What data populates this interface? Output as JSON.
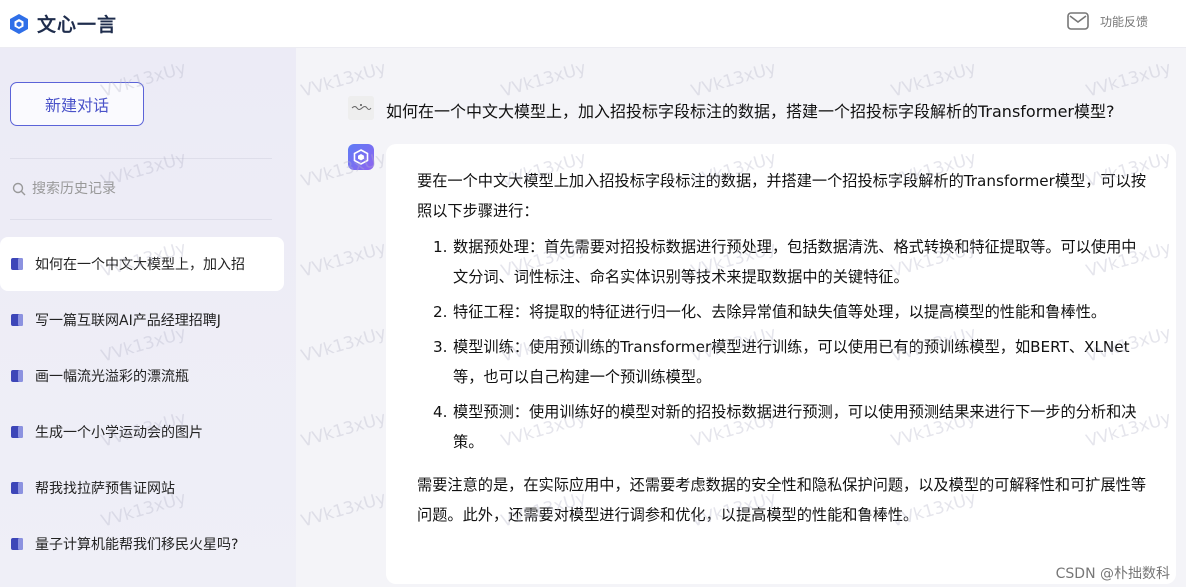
{
  "brand": {
    "name": "文心一言"
  },
  "topbar": {
    "feedback_label": "功能反馈"
  },
  "sidebar": {
    "new_chat_label": "新建对话",
    "search_placeholder": "搜索历史记录",
    "history": [
      {
        "label": "如何在一个中文大模型上，加入招",
        "active": true
      },
      {
        "label": "写一篇互联网AI产品经理招聘J",
        "active": false
      },
      {
        "label": "画一幅流光溢彩的漂流瓶",
        "active": false
      },
      {
        "label": "生成一个小学运动会的图片",
        "active": false
      },
      {
        "label": "帮我找拉萨预售证网站",
        "active": false
      },
      {
        "label": "量子计算机能帮我们移民火星吗?",
        "active": false
      }
    ]
  },
  "conversation": {
    "question": "如何在一个中文大模型上，加入招投标字段标注的数据，搭建一个招投标字段解析的Transformer模型?",
    "answer": {
      "intro": "要在一个中文大模型上加入招投标字段标注的数据，并搭建一个招投标字段解析的Transformer模型，可以按照以下步骤进行：",
      "steps": [
        {
          "num": "1.",
          "text": "数据预处理：首先需要对招投标数据进行预处理，包括数据清洗、格式转换和特征提取等。可以使用中文分词、词性标注、命名实体识别等技术来提取数据中的关键特征。"
        },
        {
          "num": "2.",
          "text": "特征工程：将提取的特征进行归一化、去除异常值和缺失值等处理，以提高模型的性能和鲁棒性。"
        },
        {
          "num": "3.",
          "text": "模型训练：使用预训练的Transformer模型进行训练，可以使用已有的预训练模型，如BERT、XLNet等，也可以自己构建一个预训练模型。"
        },
        {
          "num": "4.",
          "text": "模型预测：使用训练好的模型对新的招投标数据进行预测，可以使用预测结果来进行下一步的分析和决策。"
        }
      ],
      "note": "需要注意的是，在实际应用中，还需要考虑数据的安全性和隐私保护问题，以及模型的可解释性和可扩展性等问题。此外，还需要对模型进行调参和优化，以提高模型的性能和鲁棒性。"
    }
  },
  "watermark_text": "VVk13xUy",
  "credit": "CSDN @朴拙数科"
}
